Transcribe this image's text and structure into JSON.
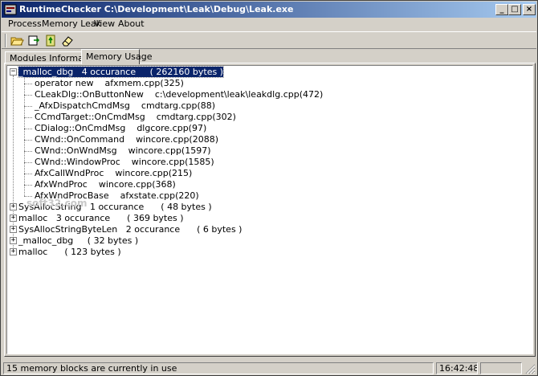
{
  "window": {
    "title": "RuntimeChecker  C:\\Development\\Leak\\Debug\\Leak.exe",
    "caption_min": "_",
    "caption_max": "□",
    "caption_close": "×"
  },
  "menu": [
    "Process",
    "Memory Leak",
    "View",
    "About"
  ],
  "toolbar": [
    "open-folder-icon",
    "export-icon",
    "refresh-icon",
    "eraser-icon"
  ],
  "tabs": [
    {
      "label": "Modules Information",
      "active": false
    },
    {
      "label": "Memory Usage",
      "active": true
    }
  ],
  "tree": {
    "root_expanded": {
      "label": "_malloc_dbg   4 occurance     ( 262160 bytes )",
      "children": [
        "operator new    afxmem.cpp(325)",
        "CLeakDlg::OnButtonNew    c:\\development\\leak\\leakdlg.cpp(472)",
        "_AfxDispatchCmdMsg    cmdtarg.cpp(88)",
        "CCmdTarget::OnCmdMsg    cmdtarg.cpp(302)",
        "CDialog::OnCmdMsg    dlgcore.cpp(97)",
        "CWnd::OnCommand    wincore.cpp(2088)",
        "CWnd::OnWndMsg    wincore.cpp(1597)",
        "CWnd::WindowProc    wincore.cpp(1585)",
        "AfxCallWndProc    wincore.cpp(215)",
        "AfxWndProc    wincore.cpp(368)",
        "AfxWndProcBase    afxstate.cpp(220)"
      ]
    },
    "collapsed": [
      "SysAllocString   1 occurance      ( 48 bytes )",
      "malloc   3 occurance      ( 369 bytes )",
      "SysAllocStringByteLen   2 occurance      ( 6 bytes )",
      "_malloc_dbg     ( 32 bytes )",
      "malloc      ( 123 bytes )"
    ],
    "expand_plus": "+",
    "expand_minus": "−"
  },
  "watermark": "soft32.com",
  "status": {
    "message": "15 memory blocks are currently in use",
    "time": "16:42:48"
  }
}
